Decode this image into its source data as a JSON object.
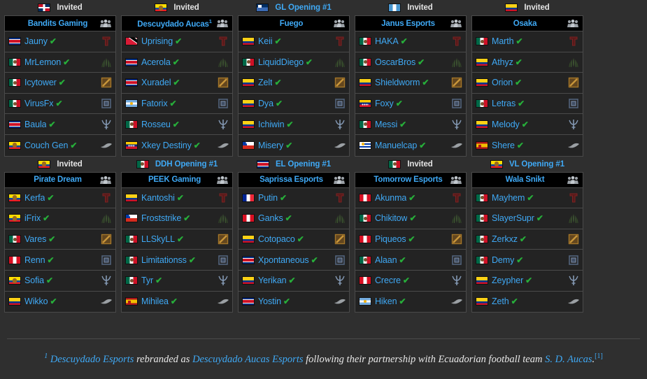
{
  "colors": {
    "background": "#2f2f2f",
    "link": "#3fa9f5",
    "header_bg": "#000000",
    "row_bg": "#232323",
    "border": "#4a4a4a",
    "check": "#27ae3a"
  },
  "icons": {
    "squad": "squad-icon",
    "positions": [
      "position-1-carry-icon",
      "position-2-mid-icon",
      "position-3-offlane-icon",
      "position-4-support-icon",
      "position-5-hard-support-icon",
      "coach-icon"
    ]
  },
  "rows": [
    {
      "cards": [
        {
          "qualifier": {
            "label": "Invited",
            "flag": "do",
            "is_link": false
          },
          "team": {
            "name": "Bandits Gaming",
            "footnote": ""
          },
          "players": [
            {
              "name": "Jauny",
              "flag": "cr",
              "verified": "✔"
            },
            {
              "name": "MrLemon",
              "flag": "mx",
              "verified": "✔"
            },
            {
              "name": "Icytower",
              "flag": "mx",
              "verified": "✔"
            },
            {
              "name": "VirusFx",
              "flag": "mx",
              "verified": "✔"
            },
            {
              "name": "Baula",
              "flag": "cr",
              "verified": "✔"
            },
            {
              "name": "Couch Gen",
              "flag": "ec",
              "verified": "✔"
            }
          ]
        },
        {
          "qualifier": {
            "label": "Invited",
            "flag": "ec",
            "is_link": false
          },
          "team": {
            "name": "Descuydado Aucas",
            "footnote": "1"
          },
          "players": [
            {
              "name": "Uprising",
              "flag": "tt",
              "verified": "✔"
            },
            {
              "name": "Acerola",
              "flag": "cr",
              "verified": "✔"
            },
            {
              "name": "Xuradel",
              "flag": "cr",
              "verified": "✔"
            },
            {
              "name": "Fatorix",
              "flag": "ar",
              "verified": "✔"
            },
            {
              "name": "Rosseu",
              "flag": "mx",
              "verified": "✔"
            },
            {
              "name": "Xkey Destiny",
              "flag": "ve",
              "verified": "✔"
            }
          ]
        },
        {
          "qualifier": {
            "label": "GL Opening #1",
            "flag": "gl",
            "is_link": true
          },
          "team": {
            "name": "Fuego",
            "footnote": ""
          },
          "players": [
            {
              "name": "Keii",
              "flag": "co",
              "verified": "✔"
            },
            {
              "name": "LiquidDiego",
              "flag": "mx",
              "verified": "✔"
            },
            {
              "name": "Zelt",
              "flag": "co",
              "verified": "✔"
            },
            {
              "name": "Dya",
              "flag": "co",
              "verified": "✔"
            },
            {
              "name": "Ichiwin",
              "flag": "co",
              "verified": "✔"
            },
            {
              "name": "Misery",
              "flag": "cl",
              "verified": "✔"
            }
          ]
        },
        {
          "qualifier": {
            "label": "Invited",
            "flag": "gt",
            "is_link": false
          },
          "team": {
            "name": "Janus Esports",
            "footnote": ""
          },
          "players": [
            {
              "name": "HAKA",
              "flag": "mx",
              "verified": "✔"
            },
            {
              "name": "OscarBros",
              "flag": "mx",
              "verified": "✔"
            },
            {
              "name": "Shieldworm",
              "flag": "co",
              "verified": "✔"
            },
            {
              "name": "Foxy",
              "flag": "ve",
              "verified": "✔"
            },
            {
              "name": "Messi",
              "flag": "mx",
              "verified": "✔"
            },
            {
              "name": "Manuelcap",
              "flag": "uy",
              "verified": "✔"
            }
          ]
        },
        {
          "qualifier": {
            "label": "Invited",
            "flag": "co",
            "is_link": false
          },
          "team": {
            "name": "Osaka",
            "footnote": ""
          },
          "players": [
            {
              "name": "Marth",
              "flag": "mx",
              "verified": "✔"
            },
            {
              "name": "Athyz",
              "flag": "co",
              "verified": "✔"
            },
            {
              "name": "Orion",
              "flag": "co",
              "verified": "✔"
            },
            {
              "name": "Letras",
              "flag": "mx",
              "verified": "✔"
            },
            {
              "name": "Melody",
              "flag": "co",
              "verified": "✔"
            },
            {
              "name": "Shere",
              "flag": "es",
              "verified": "✔"
            }
          ]
        }
      ]
    },
    {
      "cards": [
        {
          "qualifier": {
            "label": "Invited",
            "flag": "ec",
            "is_link": false
          },
          "team": {
            "name": "Pirate Dream",
            "footnote": ""
          },
          "players": [
            {
              "name": "Kerfa",
              "flag": "ec",
              "verified": "✔"
            },
            {
              "name": "iFrix",
              "flag": "ec",
              "verified": "✔"
            },
            {
              "name": "Vares",
              "flag": "mx",
              "verified": "✔"
            },
            {
              "name": "Renn",
              "flag": "pe",
              "verified": "✔"
            },
            {
              "name": "Sofia",
              "flag": "ec",
              "verified": "✔"
            },
            {
              "name": "Wikko",
              "flag": "co",
              "verified": "✔"
            }
          ]
        },
        {
          "qualifier": {
            "label": "DDH Opening #1",
            "flag": "mx",
            "is_link": true
          },
          "team": {
            "name": "PÊEK Gaming",
            "footnote": ""
          },
          "players": [
            {
              "name": "Kantoshi",
              "flag": "co",
              "verified": "✔"
            },
            {
              "name": "Froststrike",
              "flag": "cl",
              "verified": "✔"
            },
            {
              "name": "LLSkyLL",
              "flag": "mx",
              "verified": "✔"
            },
            {
              "name": "Limitationss",
              "flag": "mx",
              "verified": "✔"
            },
            {
              "name": "Tyr",
              "flag": "mx",
              "verified": "✔"
            },
            {
              "name": "Mihilea",
              "flag": "es",
              "verified": "✔"
            }
          ]
        },
        {
          "qualifier": {
            "label": "EL Opening #1",
            "flag": "cr",
            "is_link": true
          },
          "team": {
            "name": "Saprissa Esports",
            "footnote": ""
          },
          "players": [
            {
              "name": "Putin",
              "flag": "fr",
              "verified": "✔"
            },
            {
              "name": "Ganks",
              "flag": "pe",
              "verified": "✔"
            },
            {
              "name": "Cotopaco",
              "flag": "co",
              "verified": "✔"
            },
            {
              "name": "Xpontaneous",
              "flag": "cr",
              "verified": "✔"
            },
            {
              "name": "Yerikan",
              "flag": "co",
              "verified": "✔"
            },
            {
              "name": "Yostin",
              "flag": "cr",
              "verified": "✔"
            }
          ]
        },
        {
          "qualifier": {
            "label": "Invited",
            "flag": "mx",
            "is_link": false
          },
          "team": {
            "name": "Tomorrow Esports",
            "footnote": ""
          },
          "players": [
            {
              "name": "Akunma",
              "flag": "pe",
              "verified": "✔"
            },
            {
              "name": "Chikitow",
              "flag": "mx",
              "verified": "✔"
            },
            {
              "name": "Piqueos",
              "flag": "pe",
              "verified": "✔"
            },
            {
              "name": "Alaan",
              "flag": "mx",
              "verified": "✔"
            },
            {
              "name": "Crecre",
              "flag": "pe",
              "verified": "✔"
            },
            {
              "name": "Hiken",
              "flag": "ar",
              "verified": "✔"
            }
          ]
        },
        {
          "qualifier": {
            "label": "VL Opening #1",
            "flag": "ec",
            "is_link": true
          },
          "team": {
            "name": "Wala Snikt",
            "footnote": ""
          },
          "players": [
            {
              "name": "Mayhem",
              "flag": "mx",
              "verified": "✔"
            },
            {
              "name": "SlayerSupr",
              "flag": "mx",
              "verified": "✔"
            },
            {
              "name": "Zerkxz",
              "flag": "mx",
              "verified": "✔"
            },
            {
              "name": "Demy",
              "flag": "mx",
              "verified": "✔"
            },
            {
              "name": "Zeypher",
              "flag": "co",
              "verified": "✔"
            },
            {
              "name": "Zeth",
              "flag": "co",
              "verified": "✔"
            }
          ]
        }
      ]
    }
  ],
  "footnote": {
    "marker": "1",
    "link1": "Descuydado Esports",
    "text1": " rebranded as ",
    "link2": "Descuydado Aucas Esports",
    "text2": " following their partnership with Ecuadorian football team ",
    "link3": "S. D. Aucas",
    "text3": ".",
    "ref": "[1]"
  }
}
